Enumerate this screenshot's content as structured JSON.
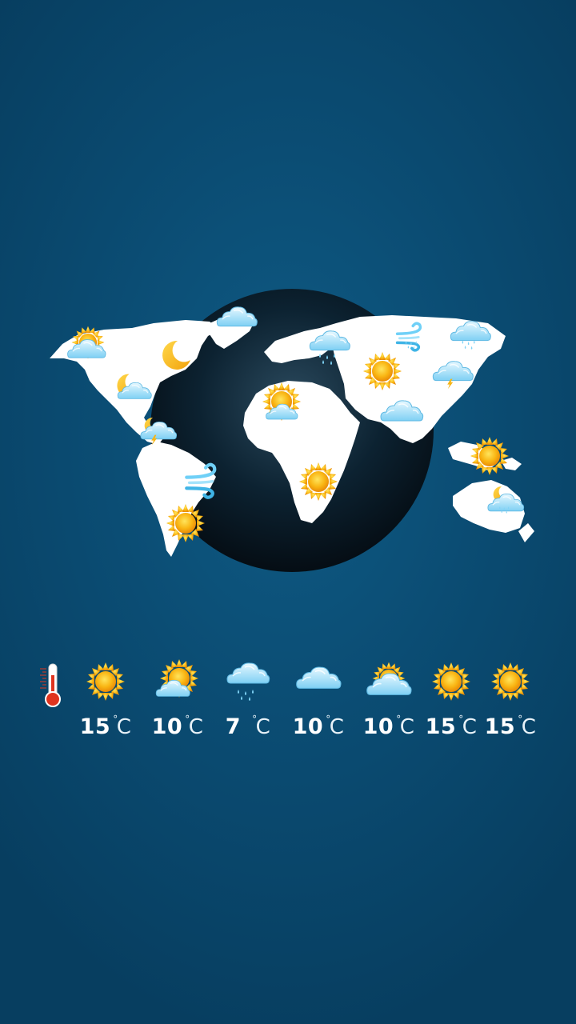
{
  "map_markers": [
    {
      "name": "alaska",
      "icon": "sun-cloud-icon"
    },
    {
      "name": "north-america-east",
      "icon": "moon-icon"
    },
    {
      "name": "north-america-west",
      "icon": "moon-cloud-icon"
    },
    {
      "name": "central-america",
      "icon": "moon-cloud-storm-icon"
    },
    {
      "name": "greenland",
      "icon": "cloud-icon"
    },
    {
      "name": "south-america-east",
      "icon": "wind-icon"
    },
    {
      "name": "south-america-south",
      "icon": "sun-icon"
    },
    {
      "name": "europe",
      "icon": "cloud-rain-icon"
    },
    {
      "name": "north-africa",
      "icon": "sun-cloud-icon"
    },
    {
      "name": "south-africa",
      "icon": "sun-icon"
    },
    {
      "name": "central-asia",
      "icon": "sun-icon"
    },
    {
      "name": "siberia-west",
      "icon": "wind-rain-icon"
    },
    {
      "name": "siberia-east",
      "icon": "cloud-rain-icon"
    },
    {
      "name": "china",
      "icon": "cloud-storm-icon"
    },
    {
      "name": "india",
      "icon": "cloud-icon"
    },
    {
      "name": "southeast-asia",
      "icon": "sun-icon"
    },
    {
      "name": "australia",
      "icon": "moon-cloud-rain-icon"
    }
  ],
  "thermometer": {
    "icon": "thermometer-icon"
  },
  "forecast": [
    {
      "icon": "sun-icon",
      "temp": "15",
      "unit": "C"
    },
    {
      "icon": "sun-cloud-icon",
      "temp": "10",
      "unit": "C"
    },
    {
      "icon": "cloud-rain-icon",
      "temp": "7",
      "unit": "C"
    },
    {
      "icon": "cloud-icon",
      "temp": "10",
      "unit": "C"
    },
    {
      "icon": "cloud-sun-icon",
      "temp": "10",
      "unit": "C"
    },
    {
      "icon": "sun-icon",
      "temp": "15",
      "unit": "C"
    },
    {
      "icon": "sun-icon",
      "temp": "15",
      "unit": "C"
    }
  ],
  "colors": {
    "background": "#0b4d74",
    "globe": "#0a1a26",
    "land": "#ffffff",
    "sun": "#f7b514",
    "cloud": "#bfe9fb",
    "temperature_text": "#ffffff"
  }
}
